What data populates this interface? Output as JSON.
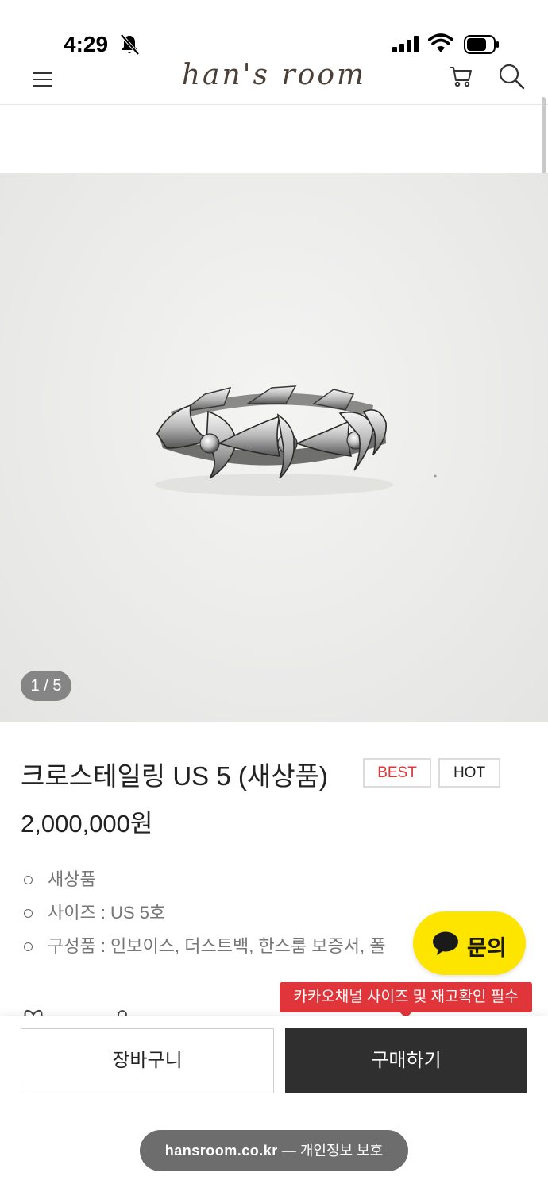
{
  "status_bar": {
    "time": "4:29"
  },
  "header": {
    "logo": "han's room"
  },
  "gallery": {
    "counter": "1 / 5"
  },
  "product": {
    "title": "크로스테일링 US 5 (새상품)",
    "badges": [
      "BEST",
      "HOT"
    ],
    "price": "2,000,000원",
    "features": [
      "새상품",
      "사이즈 : US 5호",
      "구성품 : 인보이스, 더스트백, 한스룸 보증서, 폴"
    ]
  },
  "chat": {
    "label": "문의",
    "tooltip": "카카오채널 사이즈 및 재고확인 필수"
  },
  "actions": {
    "cart_label": "장바구니",
    "buy_label": "구매하기"
  },
  "browser": {
    "domain": "hansroom.co.kr",
    "separator": " — ",
    "privacy": "개인정보 보호"
  },
  "colors": {
    "badge_best": "#e0383a",
    "chat_bg": "#fee500",
    "tooltip_bg": "#e0353b",
    "buy_button_bg": "#2f2f2f"
  }
}
